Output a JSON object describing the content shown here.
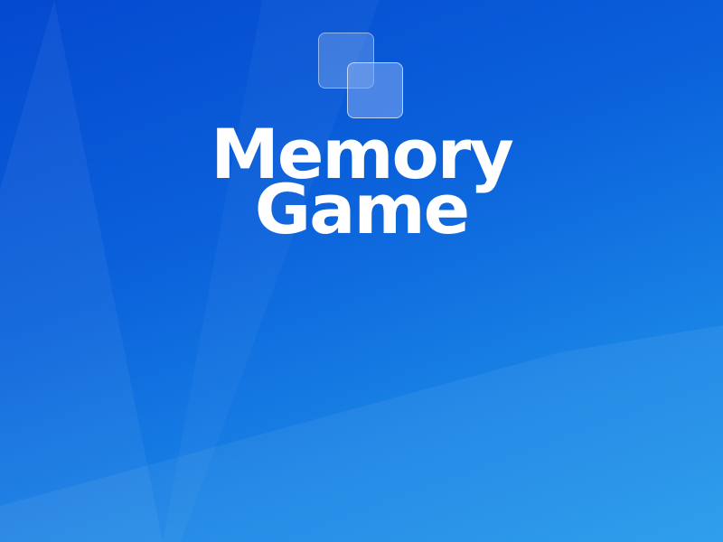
{
  "app": {
    "title_line_1": "Memory",
    "title_line_2": "Game",
    "logo_icon": "overlapping-cards-icon"
  },
  "colors": {
    "background_top": "#0449d0",
    "background_bottom": "#2299ea",
    "title": "#ffffff"
  }
}
